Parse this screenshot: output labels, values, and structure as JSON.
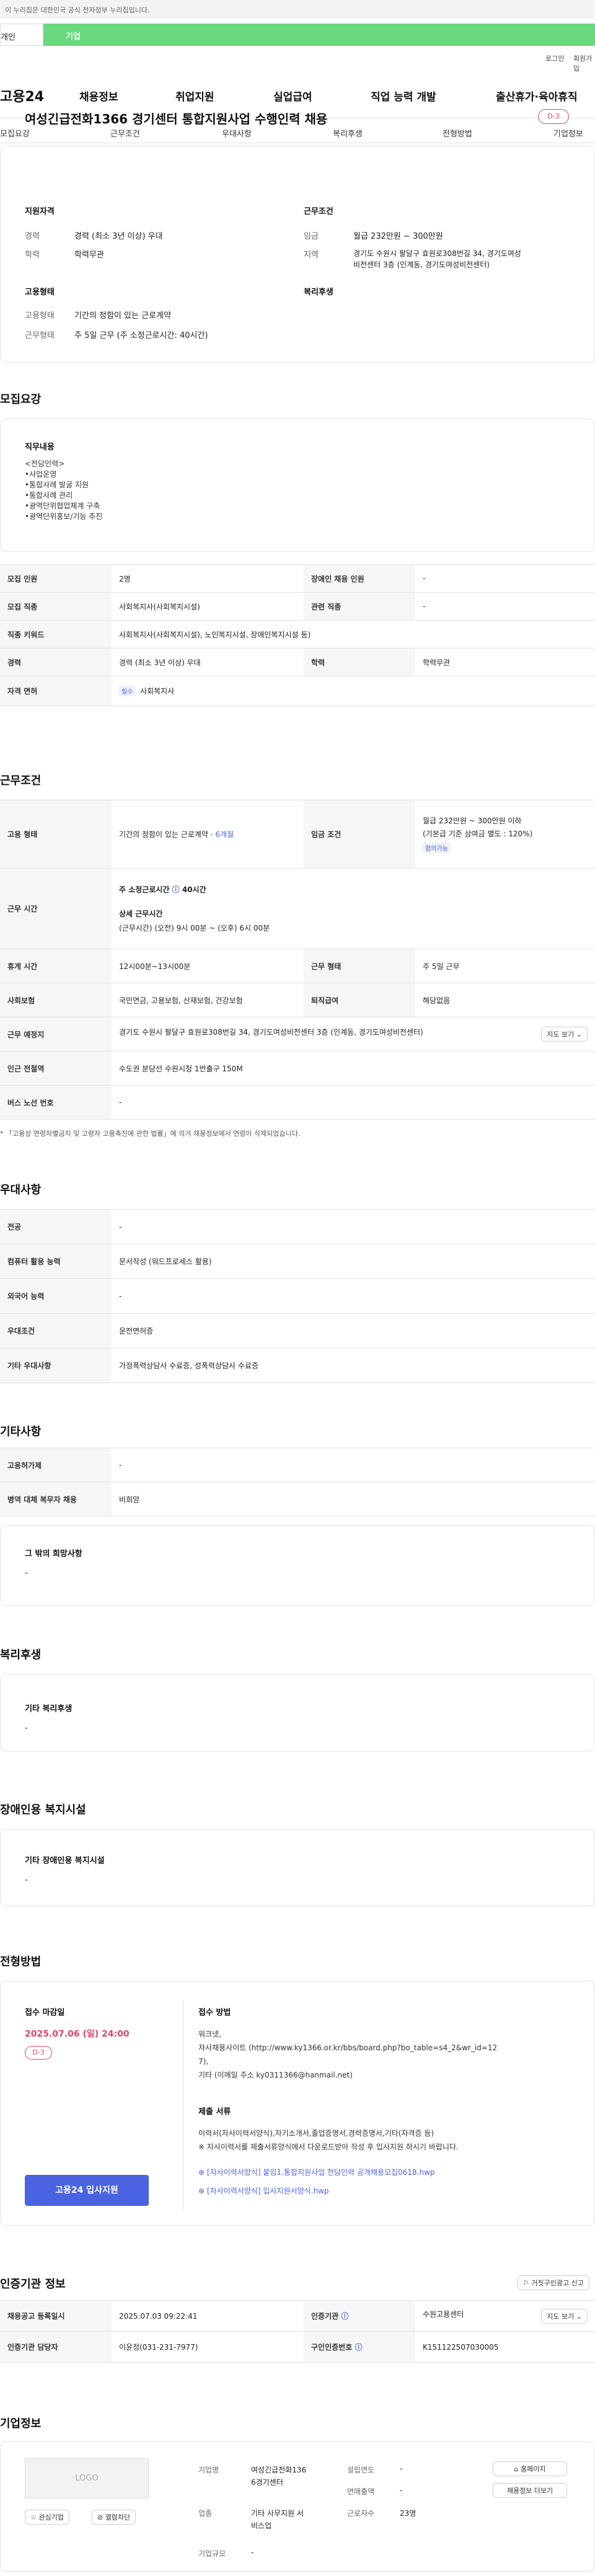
{
  "gov_notice": "이 누리집은 대한민국 공식 전자정부 누리집입니다.",
  "toggle": {
    "personal": "개인",
    "company": "기업"
  },
  "util": {
    "login": "로그인",
    "join": "회원가입"
  },
  "logo": "고용24",
  "gnb": [
    "채용정보",
    "취업지원",
    "실업급여",
    "직업 능력 개발",
    "출산휴가·육아휴직"
  ],
  "subnav": [
    "모집요강",
    "근무조건",
    "우대사항",
    "복리후생",
    "전형방법",
    "기업정보"
  ],
  "job": {
    "title": "여성긴급전화1366 경기센터 통합지원사업 수행인력 채용",
    "dday": "D-3",
    "qual_h": "지원자격",
    "career_l": "경력",
    "career_v": "경력 (최소 3년 이상) 우대",
    "edu_l": "학력",
    "edu_v": "학력무관",
    "cond_h": "근무조건",
    "wage_l": "임금",
    "wage_v": "월급 232만원 ~ 300만원",
    "region_l": "지역",
    "region_v1": "경기도 수원시 팔달구 효원로308번길 34, 경기도여성",
    "region_v2": "비전센터 3층 (인계동, 경기도여성비전센터)",
    "emp_h": "고용형태",
    "emp_l": "고용형태",
    "emp_v": "기간의 정함이 있는 근로계약",
    "work_l": "근무형태",
    "work_v": "주 5일 근무 (주 소정근로시간: 40시간)",
    "welfare_h": "복리후생"
  },
  "recruit": {
    "h": "모집요강",
    "duty_h": "직무내용",
    "duty_lines": [
      "<전담인력>",
      "•사업운영",
      "•통합사례 발굴 지원",
      "•통합사례 관리",
      "•광역단위협업체계 구축",
      "•광역단위홍보/기능 추진"
    ],
    "rows": [
      {
        "k1": "모집 인원",
        "v1": "2명",
        "k2": "장애인 채용 인원",
        "v2": "-"
      },
      {
        "k1": "모집 직종",
        "v1": "사회복지사(사회복지시설)",
        "k2": "관련 직종",
        "v2": "-"
      },
      {
        "k1": "직종 키워드",
        "v1": "사회복지사(사회복지시설), 노인복지시설, 장애인복지시설 등)"
      },
      {
        "k1": "경력",
        "v1": "경력 (최소 3년 이상) 우대",
        "k2": "학력",
        "v2": "학력무관"
      },
      {
        "k1": "자격 면허",
        "chip": "필수",
        "v1": "사회복지사"
      }
    ]
  },
  "conditions": {
    "h": "근무조건",
    "emp_k": "고용 형태",
    "emp_v": "기간의 정함이 있는 근로계약 ·",
    "emp_v2": "6개월",
    "wage_k": "임금 조건",
    "wage_v1": "월급 232만원 ~ 300만원 이하",
    "wage_v2": "(기본급 기준 상여금 별도 : 120%)",
    "wage_chip": "협의가능",
    "hours_k": "근무 시간",
    "hours_v1": "주 소정근로시간",
    "hours_v1b": "40시간",
    "hours_v2": "상세 근무시간",
    "hours_v3": "(근무시간) (오전) 9시 00분 ~ (오후) 6시 00분",
    "break_k": "휴게 시간",
    "break_v": "12시00분~13시00분",
    "form_k": "근무 형태",
    "form_v": "주 5일 근무",
    "ins_k": "사회보험",
    "ins_v": "국민연금, 고용보험, 산재보험, 건강보험",
    "ret_k": "퇴직급여",
    "ret_v": "해당없음",
    "place_k": "근무 예정지",
    "place_v": "경기도 수원시 팔달구 효원로308번길 34, 경기도여성비전센터 3층 (인계동, 경기도여성비전센터)",
    "map_btn": "지도 보기",
    "station_k": "인근 전철역",
    "station_v": "수도권 분당선 수원시청 1번출구 150M",
    "bus_k": "버스 노선 번호",
    "bus_v": "-",
    "note": "* 「고용상 연령차별금지 및 고령자 고용촉진에 관한 법률」에 의거 채용정보에서 연령이 삭제되었습니다."
  },
  "prefer": {
    "h": "우대사항",
    "rows": [
      {
        "k": "전공",
        "v": "-"
      },
      {
        "k": "컴퓨터 활용 능력",
        "v": "문서작성 (워드프로세스 활용)"
      },
      {
        "k": "외국어 능력",
        "v": "-"
      },
      {
        "k": "우대조건",
        "v": "운전면허증"
      },
      {
        "k": "기타 우대사항",
        "v": "가정폭력상담사 수료증, 성폭력상담사 수료증"
      }
    ]
  },
  "etc": {
    "h": "기타사항",
    "rows": [
      {
        "k": "고용허가제",
        "v": "-"
      },
      {
        "k": "병역 대체 복무자 채용",
        "v": "비희망"
      }
    ],
    "box_h": "그 밖의 희망사항",
    "box_v": "-"
  },
  "welfare": {
    "h": "복리후생",
    "box_h": "기타 복리후생",
    "box_v": "-"
  },
  "disabled": {
    "h": "장애인용 복지시설",
    "box_h": "기타 장애인용 복지시설",
    "box_v": "-"
  },
  "process": {
    "h": "전형방법",
    "deadline_h": "접수 마감일",
    "deadline_v": "2025.07.06 (일) 24:00",
    "dday": "D-3",
    "apply_btn": "고용24 입사지원",
    "method_h": "접수 방법",
    "method_lines": [
      "워크넷,",
      "자사채용사이트 (http://www.ky1366.or.kr/bbs/board.php?bo_table=s4_2&wr_id=12",
      "7),",
      "기타 (이메일 주소 ky0311366@hanmail.net)"
    ],
    "docs_h": "제출 서류",
    "docs_lines": [
      "이력서(자사이력서양식),자기소개서,졸업증명서,경력증명서,기타(자격증 등)",
      "※ 자사이력서를 제출서류양식에서 다운로드받아 작성 후 입사지원 하시기 바랍니다."
    ],
    "file1": "[자사이력서양식] 붙임1.통합지원사업 전담인력 공개채용모집0618.hwp",
    "file2": "[자사이력서양식] 입사지원서양식.hwp"
  },
  "cert": {
    "h": "인증기관 정보",
    "report_btn": "거짓구인광고 신고",
    "reg_k": "채용공고 등록일시",
    "reg_v": "2025.07.03 09:22:41",
    "org_k": "인증기관",
    "org_v": "수원고용센터",
    "map_btn": "지도 보기",
    "mgr_k": "인증기관 담당자",
    "mgr_v": "이윤정(031-231-7977)",
    "auth_k": "구인인증번호",
    "auth_v": "K151122507030005"
  },
  "company": {
    "h": "기업정보",
    "logo": "LOGO",
    "fav_btn": "관심기업",
    "block_btn": "열람차단",
    "name_k": "기업명",
    "name_v1": "여성긴급전화136",
    "name_v2": "6경기센터",
    "ind_k": "업종",
    "ind_v1": "기타 사무지원 서",
    "ind_v2": "비스업",
    "size_k": "기업규모",
    "size_v": "-",
    "est_k": "설립연도",
    "est_v": "-",
    "sales_k": "연매출액",
    "sales_v": "-",
    "emp_k": "근로자수",
    "emp_v": "23명",
    "home_btn": "홈페이지",
    "more_btn": "채용정보 더보기"
  }
}
